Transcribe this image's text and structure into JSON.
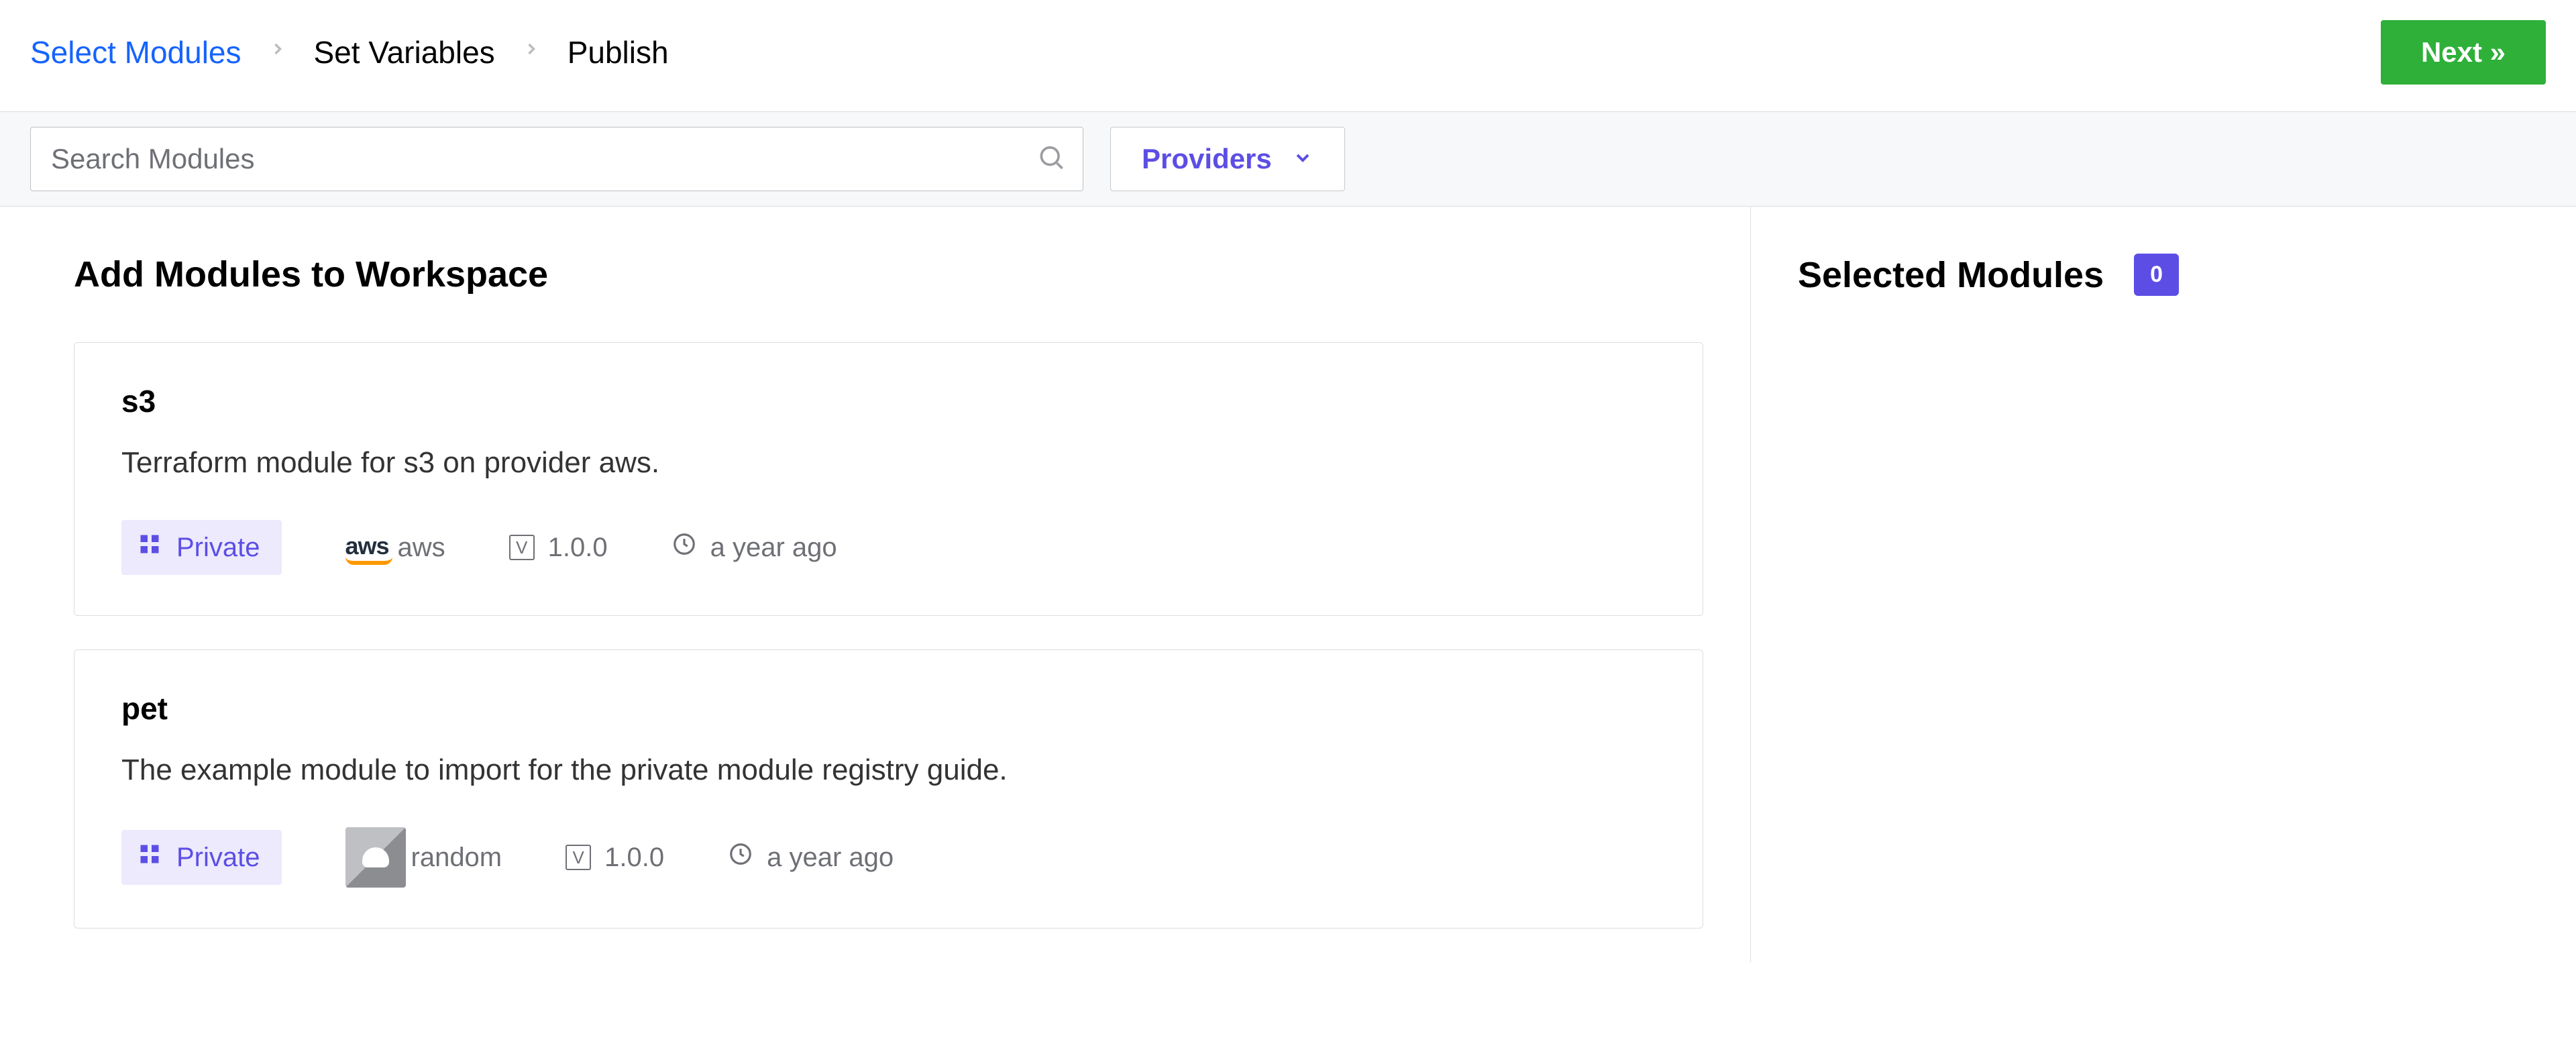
{
  "breadcrumb": {
    "step1": "Select Modules",
    "step2": "Set Variables",
    "step3": "Publish"
  },
  "header": {
    "next_label": "Next »"
  },
  "filter": {
    "search_placeholder": "Search Modules",
    "providers_label": "Providers"
  },
  "main": {
    "title": "Add Modules to Workspace"
  },
  "sidebar": {
    "title": "Selected Modules",
    "count": "0"
  },
  "modules": [
    {
      "name": "s3",
      "description": "Terraform module for s3 on provider aws.",
      "visibility": "Private",
      "provider_name": "aws",
      "provider_logo": "aws",
      "version": "1.0.0",
      "updated": "a year ago"
    },
    {
      "name": "pet",
      "description": "The example module to import for the private module registry guide.",
      "visibility": "Private",
      "provider_name": "random",
      "provider_logo": "random",
      "version": "1.0.0",
      "updated": "a year ago"
    }
  ]
}
